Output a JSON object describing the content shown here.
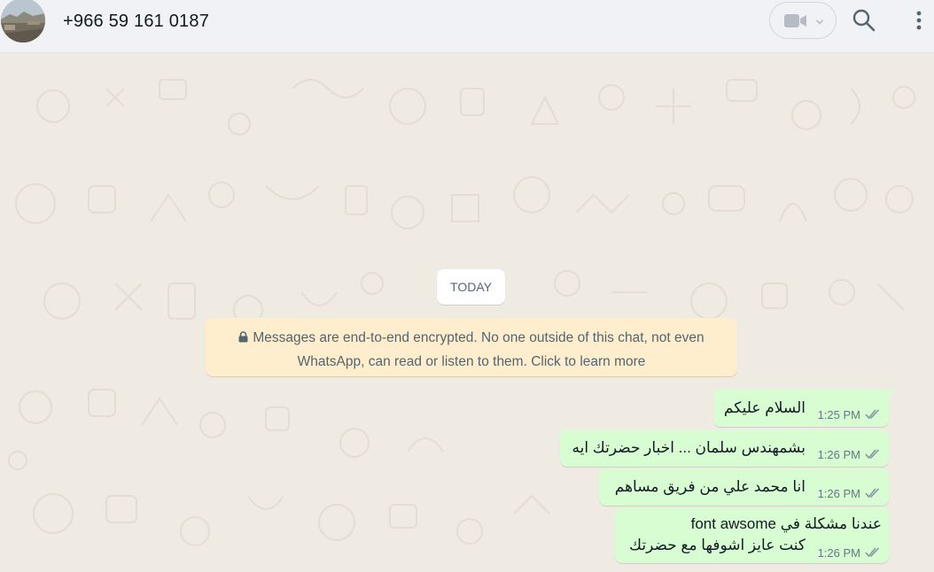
{
  "header": {
    "contact_name": "+966 59 161 0187",
    "avatar_icon": "contact-photo",
    "video_call_icon": "video-camera-icon",
    "dropdown_icon": "chevron-down-icon",
    "search_icon": "search-icon",
    "menu_icon": "kebab-menu-icon"
  },
  "chat": {
    "date_label": "TODAY",
    "encryption_notice_line1": "Messages are end-to-end encrypted. No one outside of this chat, not even",
    "encryption_notice_line2": "WhatsApp, can read or listen to them. Click to learn more",
    "messages": [
      {
        "text": "السلام عليكم",
        "time": "1:25 PM",
        "status": "read"
      },
      {
        "text": "بشمهندس سلمان ... اخبار حضرتك ايه",
        "time": "1:26 PM",
        "status": "read"
      },
      {
        "text": "انا محمد علي من فريق مساهم",
        "time": "1:26 PM",
        "status": "read"
      },
      {
        "text_line1": "عندنا مشكلة في  font awsome",
        "text_line2": "كنت عايز اشوفها مع حضرتك",
        "time": "1:26 PM",
        "status": "read"
      }
    ]
  },
  "colors": {
    "outgoing_bubble": "#d9fdd3",
    "read_ticks": "#8696a0",
    "chat_background": "#efeae2",
    "notice_background": "#ffeecd"
  }
}
